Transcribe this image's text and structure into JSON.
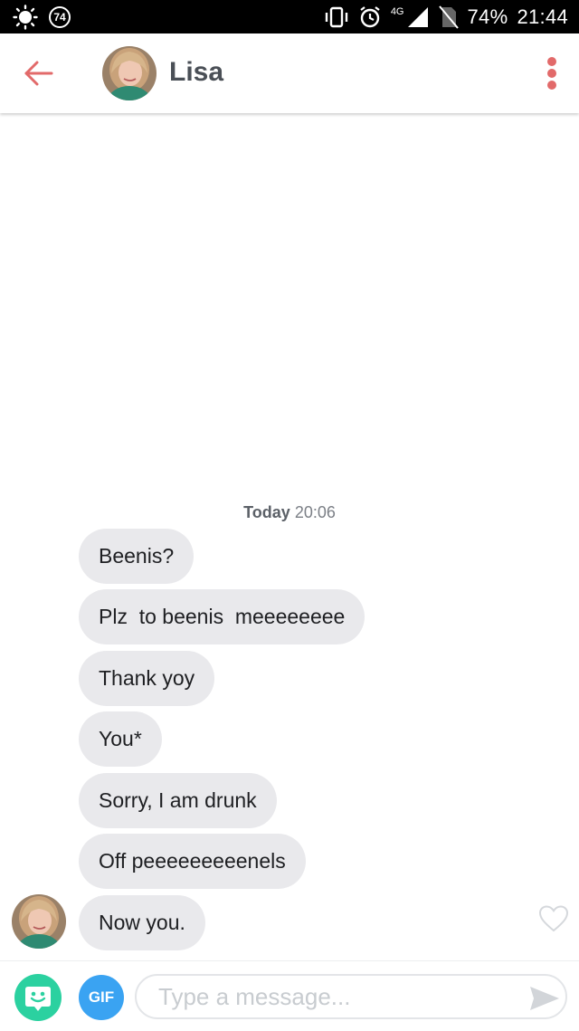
{
  "status_bar": {
    "notification_count": "74",
    "network": "4G",
    "battery": "74%",
    "time": "21:44"
  },
  "header": {
    "contact_name": "Lisa"
  },
  "conversation": {
    "date_label": "Today",
    "time_label": "20:06",
    "messages": [
      {
        "text": "Beenis?"
      },
      {
        "text": "Plz  to beenis  meeeeeeee"
      },
      {
        "text": "Thank yoy"
      },
      {
        "text": "You*"
      },
      {
        "text": "Sorry, I am drunk"
      },
      {
        "text": "Off peeeeeeeeenels"
      },
      {
        "text": "Now you."
      }
    ]
  },
  "composer": {
    "gif_label": "GIF",
    "placeholder": "Type a message..."
  },
  "colors": {
    "accent": "#e26a6a",
    "bubble": "#e9e9ec",
    "gif": "#3aa3f2",
    "sticker": "#2bd1a0"
  }
}
